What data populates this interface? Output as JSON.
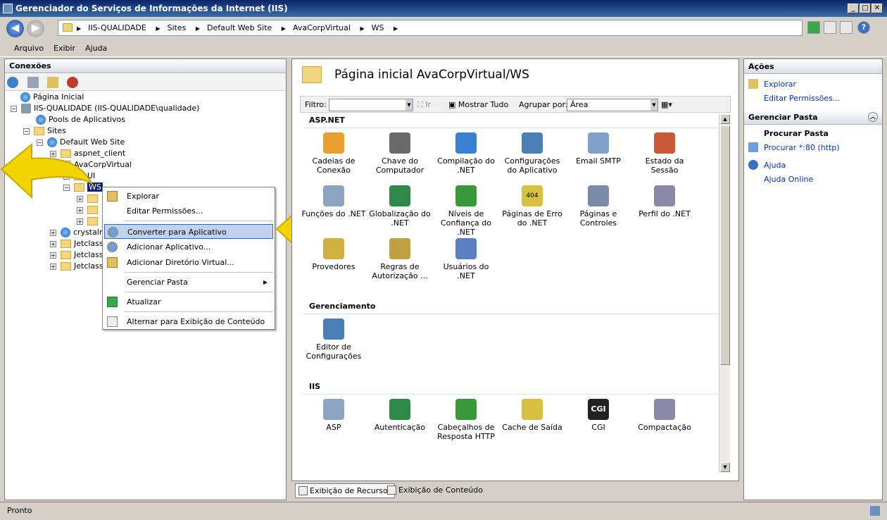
{
  "window": {
    "title": "Gerenciador do Serviços de Informações da Internet (IIS)"
  },
  "address": {
    "crumbs": [
      "IIS-QUALIDADE",
      "Sites",
      "Default Web Site",
      "AvaCorpVirtual",
      "WS"
    ]
  },
  "menu": [
    "Arquivo",
    "Exibir",
    "Ajuda"
  ],
  "connections": {
    "title": "Conexões",
    "tree": [
      {
        "label": "Página Inicial",
        "level": 0
      },
      {
        "label": "IIS-QUALIDADE (IIS-QUALIDADE\\qualidade)",
        "level": 0
      },
      {
        "label": "Pools de Aplicativos",
        "level": 1
      },
      {
        "label": "Sites",
        "level": 1
      },
      {
        "label": "Default Web Site",
        "level": 2
      },
      {
        "label": "aspnet_client",
        "level": 3
      },
      {
        "label": "AvaCorpVirtual",
        "level": 3
      },
      {
        "label": "UI",
        "level": 4
      },
      {
        "label": "WS",
        "level": 4
      },
      {
        "label": "crystalre",
        "level": 3
      },
      {
        "label": "Jetclass",
        "level": 3
      },
      {
        "label": "Jetclass",
        "level": 3
      },
      {
        "label": "Jetclass",
        "level": 3
      }
    ]
  },
  "context_menu": [
    "Explorar",
    "Editar Permissões...",
    "Converter para Aplicativo",
    "Adicionar Aplicativo...",
    "Adicionar Diretório Virtual...",
    "Gerenciar Pasta",
    "Atualizar",
    "Alternar para Exibição de Conteúdo"
  ],
  "main": {
    "title": "Página inicial AvaCorpVirtual/WS",
    "filter_label": "Filtro:",
    "go_label": "Ir",
    "show_all": "Mostrar Tudo",
    "group_label": "Agrupar por:",
    "group_value": "Área",
    "sections": [
      {
        "name": "ASP.NET",
        "items": [
          "Cadeias de Conexão",
          "Chave do Computador",
          "Compilação do .NET",
          "Configurações do Aplicativo",
          "Email SMTP",
          "Estado da Sessão",
          "Funções do .NET",
          "Globalização do .NET",
          "Níveis de Confiança do .NET",
          "Páginas de Erro do .NET",
          "Páginas e Controles",
          "Perfil do .NET",
          "Provedores",
          "Regras de Autorização ...",
          "Usuários do .NET"
        ]
      },
      {
        "name": "Gerenciamento",
        "items": [
          "Editor de Configurações"
        ]
      },
      {
        "name": "IIS",
        "items": [
          "ASP",
          "Autenticação",
          "Cabeçalhos de Resposta HTTP",
          "Cache de Saída",
          "CGI",
          "Compactação"
        ]
      }
    ],
    "cgi_icon_text": "CGI",
    "error_icon_text": "404"
  },
  "bottom_tabs": [
    "Exibição de Recursos",
    "Exibição de Conteúdo"
  ],
  "actions": {
    "title": "Ações",
    "items": [
      "Explorar",
      "Editar Permissões..."
    ],
    "folder_head": "Gerenciar Pasta",
    "browse_head": "Procurar Pasta",
    "browse_link": "Procurar *:80 (http)",
    "help": [
      "Ajuda",
      "Ajuda Online"
    ]
  },
  "status": "Pronto"
}
